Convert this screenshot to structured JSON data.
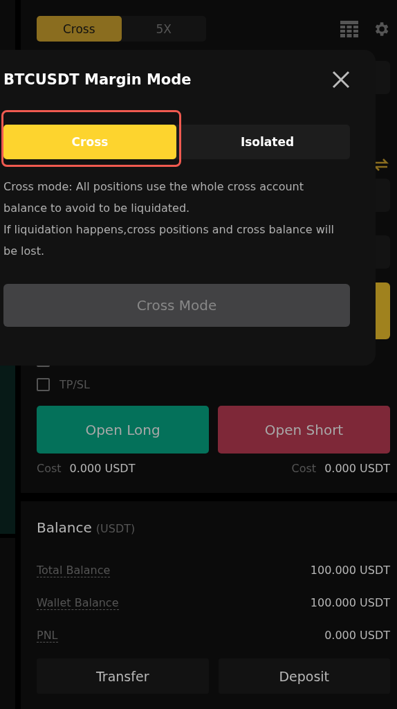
{
  "trade_panel": {
    "margin_mode": [
      {
        "label": "Cross",
        "selected": true
      },
      {
        "label": "5X",
        "selected": false
      }
    ],
    "options": [
      {
        "checked": false
      },
      {
        "label": "TP/SL",
        "checked": false
      }
    ],
    "actions": [
      {
        "label": "Open Long",
        "kind": "long",
        "cost_label": "Cost",
        "cost": "0.000 USDT"
      },
      {
        "label": "Open Short",
        "kind": "short",
        "cost_label": "Cost",
        "cost": "0.000 USDT"
      }
    ]
  },
  "balance": {
    "title": "Balance",
    "unit": "(USDT)",
    "rows": [
      {
        "label": "Total Balance",
        "value": "100.000 USDT"
      },
      {
        "label": "Wallet Balance",
        "value": "100.000 USDT"
      },
      {
        "label": "PNL",
        "value": "0.000 USDT"
      }
    ],
    "buttons": [
      "Transfer",
      "Deposit"
    ]
  },
  "dialog": {
    "title": "BTCUSDT Margin Mode",
    "modes": [
      {
        "label": "Cross",
        "selected": true
      },
      {
        "label": "Isolated",
        "selected": false
      }
    ],
    "description": [
      "Cross mode: All positions use the whole cross account balance to avoid to be liquidated.",
      "If liquidation happens,cross positions and cross balance will be lost."
    ],
    "confirm": "Cross Mode"
  }
}
